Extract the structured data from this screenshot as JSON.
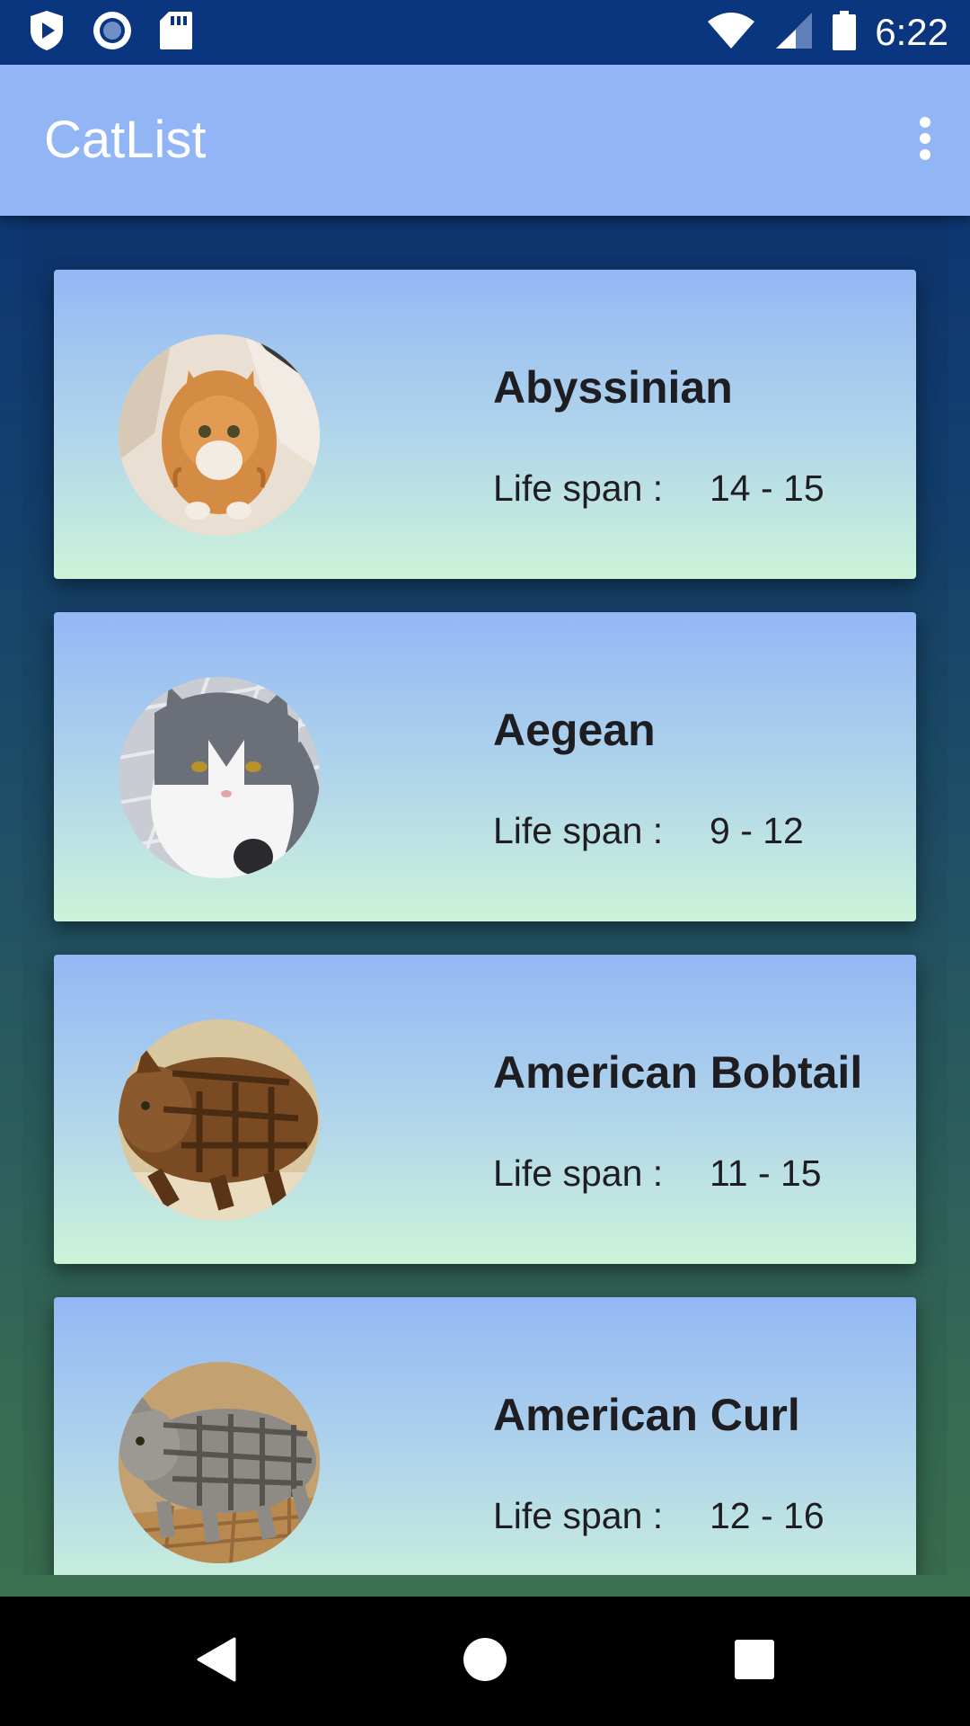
{
  "status_bar": {
    "time": "6:22",
    "left_icons": [
      "play-protect-icon",
      "radio-icon",
      "sd-card-icon"
    ],
    "right_icons": [
      "wifi-icon",
      "signal-icon",
      "battery-icon"
    ]
  },
  "app_bar": {
    "title": "CatList",
    "menu_icon": "more-vert-icon"
  },
  "cats": [
    {
      "name": "Abyssinian",
      "life_label": "Life span :",
      "life_span": "14 - 15"
    },
    {
      "name": "Aegean",
      "life_label": "Life span :",
      "life_span": "9 - 12"
    },
    {
      "name": "American Bobtail",
      "life_label": "Life span :",
      "life_span": "11 - 15"
    },
    {
      "name": "American Curl",
      "life_label": "Life span :",
      "life_span": "12 - 16"
    }
  ],
  "nav_bar": {
    "buttons": [
      "back-icon",
      "home-icon",
      "recents-icon"
    ]
  },
  "colors": {
    "status_bar": "#0a357f",
    "app_bar": "#92b6f5",
    "card_top": "#93b8f4",
    "card_bottom": "#cdf3d9",
    "text": "#1e1e22"
  }
}
